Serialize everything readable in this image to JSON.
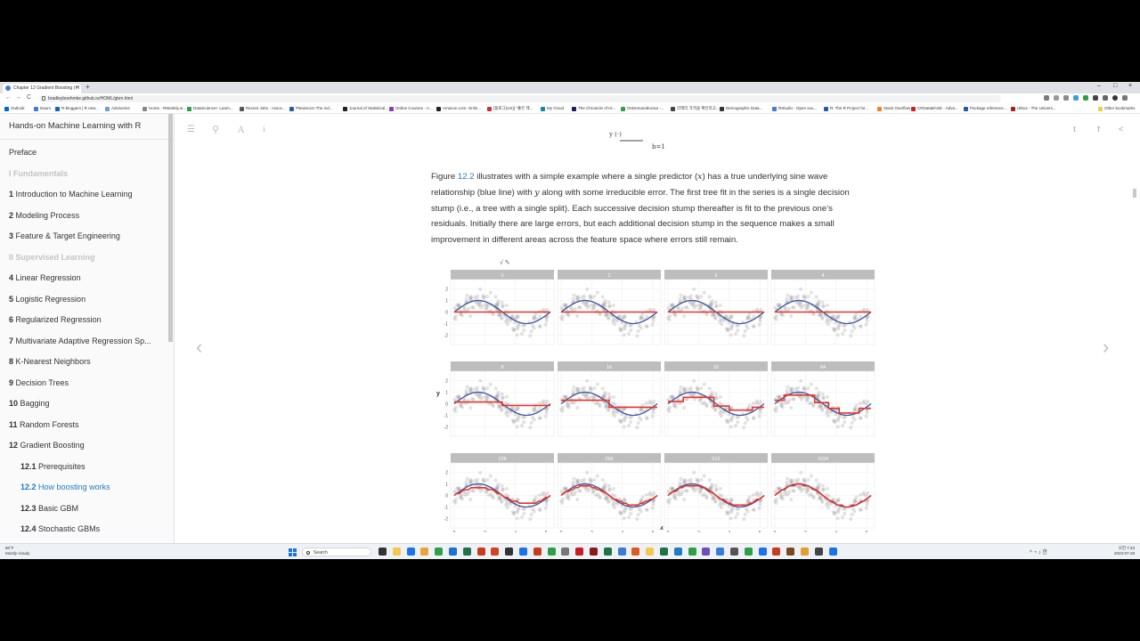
{
  "browser": {
    "tab_title": "Chapter 12 Gradient Boosting | H",
    "tab_close": "×",
    "new_tab": "+",
    "url": "bradleyboehmke.github.io/HOML/gbm.html",
    "window_controls": [
      "–",
      "□",
      "×"
    ],
    "nav": {
      "back": "←",
      "forward": "→",
      "reload": "C"
    },
    "bookmarks": [
      {
        "label": "Outlook",
        "color": "#0a64c8"
      },
      {
        "label": "Daum",
        "color": "#3d7bd9"
      },
      {
        "label": "R-bloggers | R new...",
        "color": "#1a5fb4"
      },
      {
        "label": "Advisories",
        "color": "#6fa0d0"
      },
      {
        "label": "Home - RWeekly.or...",
        "color": "#888888"
      },
      {
        "label": "DataScience+ Learn...",
        "color": "#2e9f46"
      },
      {
        "label": "Recent Jobs - Assoc...",
        "color": "#555555"
      },
      {
        "label": "Planetcorn The ind...",
        "color": "#2a58a8"
      },
      {
        "label": "Journal of Statistical...",
        "color": "#222222"
      },
      {
        "label": "Online Courses - A...",
        "color": "#8a3ab9"
      },
      {
        "label": "Amazon.com: Onlin...",
        "color": "#222222"
      },
      {
        "label": "[블로그(US)] \"좋은 책...",
        "color": "#cc3333"
      },
      {
        "label": "My Cloud",
        "color": "#138a9c"
      },
      {
        "label": "The Chronicle of Hi...",
        "color": "#1a1a66"
      },
      {
        "label": "OnDemandKorea -...",
        "color": "#2e9f46"
      },
      {
        "label": "리액티 가격을 확인하고...",
        "color": "#444444"
      },
      {
        "label": "Demographic Data...",
        "color": "#333333"
      },
      {
        "label": "RStudio - Open sou...",
        "color": "#4a7bd0"
      },
      {
        "label": "R: The R Project for...",
        "color": "#2a58a8"
      },
      {
        "label": "Stack Overflow",
        "color": "#f48024"
      },
      {
        "label": "CRDataBASE - Adva...",
        "color": "#cc2222"
      },
      {
        "label": "Package reference...",
        "color": "#2a58a8"
      },
      {
        "label": "Utbox - The Univers...",
        "color": "#b01c1c"
      }
    ],
    "other_bookmarks": "Other bookmarks"
  },
  "sidebar": {
    "book_title": "Hands-on Machine Learning with R",
    "items": [
      {
        "num": "",
        "label": "Preface",
        "kind": "chapter"
      },
      {
        "num": "",
        "label": "I Fundamentals",
        "kind": "part"
      },
      {
        "num": "1",
        "label": "Introduction to Machine Learning",
        "kind": "chapter"
      },
      {
        "num": "2",
        "label": "Modeling Process",
        "kind": "chapter"
      },
      {
        "num": "3",
        "label": "Feature & Target Engineering",
        "kind": "chapter"
      },
      {
        "num": "",
        "label": "II Supervised Learning",
        "kind": "part"
      },
      {
        "num": "4",
        "label": "Linear Regression",
        "kind": "chapter"
      },
      {
        "num": "5",
        "label": "Logistic Regression",
        "kind": "chapter"
      },
      {
        "num": "6",
        "label": "Regularized Regression",
        "kind": "chapter"
      },
      {
        "num": "7",
        "label": "Multivariate Adaptive Regression Sp...",
        "kind": "chapter"
      },
      {
        "num": "8",
        "label": "K-Nearest Neighbors",
        "kind": "chapter"
      },
      {
        "num": "9",
        "label": "Decision Trees",
        "kind": "chapter"
      },
      {
        "num": "10",
        "label": "Bagging",
        "kind": "chapter"
      },
      {
        "num": "11",
        "label": "Random Forests",
        "kind": "chapter"
      },
      {
        "num": "12",
        "label": "Gradient Boosting",
        "kind": "chapter"
      },
      {
        "num": "12.1",
        "label": "Prerequisites",
        "kind": "section"
      },
      {
        "num": "12.2",
        "label": "How boosting works",
        "kind": "section-active"
      },
      {
        "num": "12.3",
        "label": "Basic GBM",
        "kind": "section"
      },
      {
        "num": "12.4",
        "label": "Stochastic GBMs",
        "kind": "section"
      }
    ]
  },
  "toolbar": {
    "menu_icon": "☰",
    "search_icon": "⚲",
    "font_icon": "A",
    "info_icon": "i",
    "twitter_icon": "t",
    "facebook_icon": "f",
    "share_icon": "<"
  },
  "content": {
    "formula_fragment": "b=1",
    "paragraph": {
      "p1": "Figure ",
      "link": "12.2",
      "p2": " illustrates with a simple example where a single predictor (",
      "var_x": "x",
      "p3": ") has a true underlying sine wave relationship (blue line) with ",
      "var_y": "y",
      "p4": " along with some irreducible error. The first tree fit in the series is a single decision stump (i.e., a tree with a single split). Each successive decision stump thereafter is fit to the previous one’s residuals. Initially there are large errors, but each additional decision stump in the sequence makes a small improvement in different areas across the feature space where errors still remain."
    },
    "prev_arrow": "‹",
    "next_arrow": "›",
    "annotation": "√  ✎"
  },
  "chart_data": {
    "type": "scatter",
    "facet_titles": [
      "0",
      "1",
      "2",
      "4",
      "8",
      "16",
      "32",
      "64",
      "128",
      "256",
      "512",
      "1024"
    ],
    "x_ticks": [
      "0",
      "2",
      "4",
      "6"
    ],
    "y_ticks": [
      "2",
      "1",
      "0",
      "-1",
      "-2"
    ],
    "xlabel": "x",
    "ylabel": "y",
    "xlim": [
      0,
      6.28
    ],
    "ylim": [
      -2.5,
      2.5
    ],
    "true_function": {
      "name": "sin(x)",
      "color": "#3a53a4"
    },
    "prediction_color": "#e8332a",
    "points_color": "#9a9a9a",
    "stump_predictions": [
      {
        "facet": "0",
        "steps": [
          [
            0,
            6.28,
            0
          ]
        ]
      },
      {
        "facet": "1",
        "steps": [
          [
            0,
            6.28,
            0
          ]
        ]
      },
      {
        "facet": "2",
        "steps": [
          [
            0,
            6.28,
            0
          ]
        ]
      },
      {
        "facet": "4",
        "steps": [
          [
            0,
            6.28,
            0
          ]
        ]
      },
      {
        "facet": "8",
        "steps": [
          [
            0,
            3.14,
            0.15
          ],
          [
            3.14,
            6.28,
            -0.15
          ]
        ]
      },
      {
        "facet": "16",
        "steps": [
          [
            0,
            3.14,
            0.3
          ],
          [
            3.14,
            6.28,
            -0.3
          ]
        ]
      },
      {
        "facet": "32",
        "steps": [
          [
            0,
            1.0,
            0.2
          ],
          [
            1.0,
            3.0,
            0.55
          ],
          [
            3.0,
            4.0,
            -0.2
          ],
          [
            4.0,
            5.5,
            -0.55
          ],
          [
            5.5,
            6.28,
            -0.3
          ]
        ]
      },
      {
        "facet": "64",
        "steps": [
          [
            0,
            0.6,
            0.3
          ],
          [
            0.6,
            2.6,
            0.75
          ],
          [
            2.6,
            3.5,
            0.1
          ],
          [
            3.5,
            4.2,
            -0.4
          ],
          [
            4.2,
            5.5,
            -0.8
          ],
          [
            5.5,
            6.28,
            -0.4
          ]
        ]
      },
      {
        "facet": "128",
        "steps": "smooth"
      },
      {
        "facet": "256",
        "steps": "smooth"
      },
      {
        "facet": "512",
        "steps": "smooth"
      },
      {
        "facet": "1024",
        "steps": "smooth"
      }
    ]
  },
  "taskbar": {
    "weather_temp": "80°F",
    "weather_desc": "Mostly cloudy",
    "search_placeholder": "Search",
    "time": "오전 7:23",
    "date": "2023-07-28",
    "lang": "한"
  }
}
